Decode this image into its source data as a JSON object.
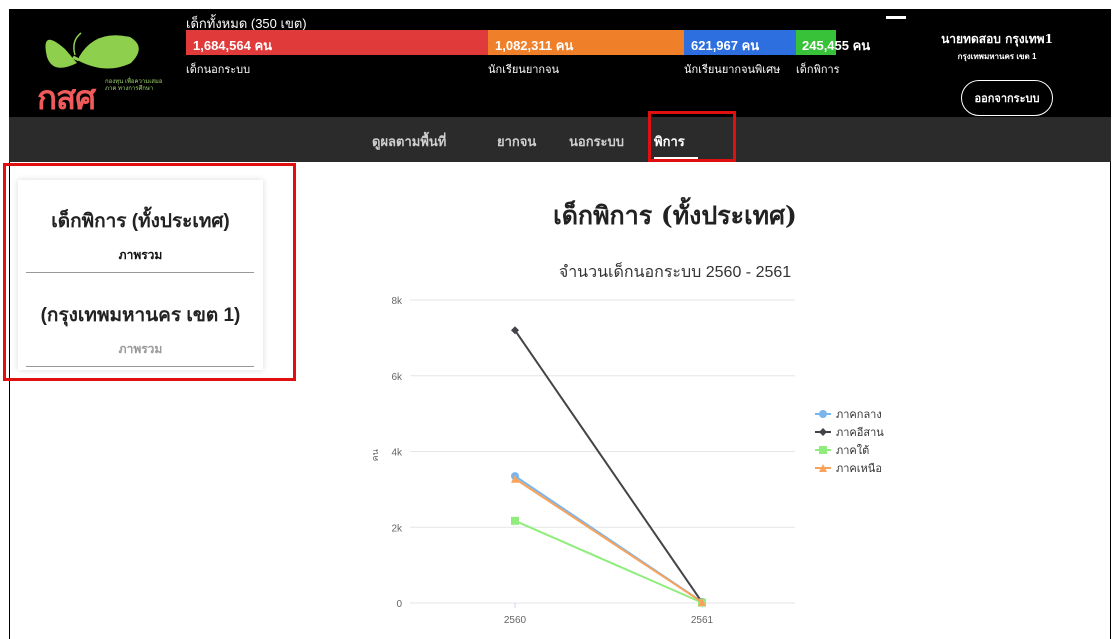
{
  "header": {
    "logo_text": "กสศ",
    "logo_subtext": "กองทุน เพื่อความเสมอภาค ทางการศึกษา",
    "total_label": "เด็กทั้งหมด (350 เขต)",
    "bars": [
      {
        "value": "1,684,564 คน",
        "label": "เด็กนอกระบบ",
        "color": "#e03a3a"
      },
      {
        "value": "1,082,311 คน",
        "label": "นักเรียนยากจน",
        "color": "#f07f2a"
      },
      {
        "value": "621,967 คน",
        "label": "นักเรียนยากจนพิเศษ",
        "color": "#2e6fe0"
      },
      {
        "value": "245,455 คน",
        "label": "เด็กพิการ",
        "color": "#38c23a"
      }
    ],
    "user_name": "นายทดสอบ กรุงเทพ1",
    "user_area": "กรุงเทพมหานคร เขต 1",
    "logout_label": "ออกจากระบบ"
  },
  "nav": {
    "items": [
      {
        "label": "ดูผลตามพื้นที่"
      },
      {
        "label": "ยากจน"
      },
      {
        "label": "นอกระบบ"
      },
      {
        "label": "พิการ"
      }
    ],
    "active_index": 3
  },
  "sidebar": {
    "title_country": "เด็กพิการ (ทั้งประเทศ)",
    "overview_1": "ภาพรวม",
    "title_area": "(กรุงเทพมหานคร เขต 1)",
    "overview_2": "ภาพรวม"
  },
  "main": {
    "title": "เด็กพิการ (ทั้งประเทศ)"
  },
  "chart_data": {
    "type": "line",
    "title": "จำนวนเด็กนอกระบบ 2560 - 2561",
    "xlabel": "",
    "ylabel": "คน",
    "categories": [
      "2560",
      "2561"
    ],
    "yticks": [
      "0",
      "2k",
      "4k",
      "6k",
      "8k"
    ],
    "ylim": [
      0,
      8000
    ],
    "grid": true,
    "legend": "right",
    "series": [
      {
        "name": "ภาคกลาง",
        "values": [
          3350,
          30
        ],
        "color": "#7cb5ec",
        "marker": "circle"
      },
      {
        "name": "ภาคอีสาน",
        "values": [
          7200,
          20
        ],
        "color": "#434348",
        "marker": "diamond"
      },
      {
        "name": "ภาคใต้",
        "values": [
          2170,
          10
        ],
        "color": "#90ed7d",
        "marker": "square"
      },
      {
        "name": "ภาคเหนือ",
        "values": [
          3280,
          25
        ],
        "color": "#f7a35c",
        "marker": "triangle"
      }
    ]
  }
}
